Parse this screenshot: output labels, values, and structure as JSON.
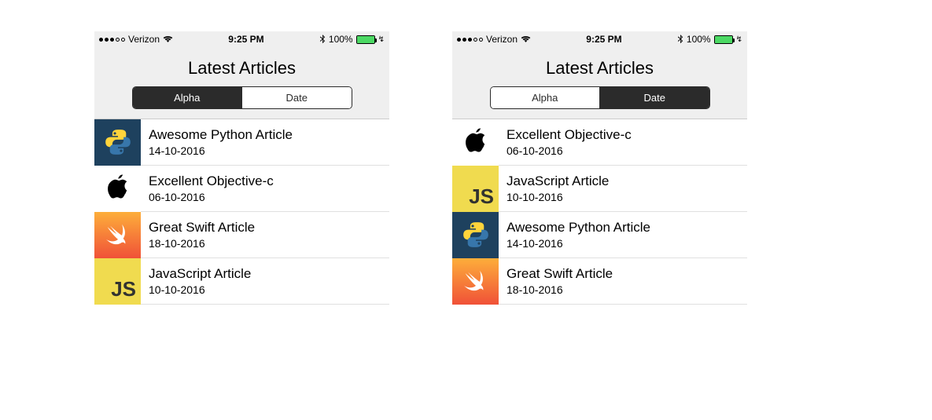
{
  "status": {
    "carrier": "Verizon",
    "time": "9:25 PM",
    "battery_pct": "100%"
  },
  "header": {
    "title": "Latest Articles",
    "segments": [
      "Alpha",
      "Date"
    ]
  },
  "screens": [
    {
      "active_segment": 0,
      "rows": [
        {
          "icon": "python",
          "title": "Awesome Python Article",
          "date": "14-10-2016"
        },
        {
          "icon": "apple",
          "title": "Excellent Objective-c",
          "date": "06-10-2016"
        },
        {
          "icon": "swift",
          "title": "Great Swift Article",
          "date": "18-10-2016"
        },
        {
          "icon": "js",
          "title": "JavaScript Article",
          "date": "10-10-2016"
        }
      ]
    },
    {
      "active_segment": 1,
      "rows": [
        {
          "icon": "apple",
          "title": "Excellent Objective-c",
          "date": "06-10-2016"
        },
        {
          "icon": "js",
          "title": "JavaScript Article",
          "date": "10-10-2016"
        },
        {
          "icon": "python",
          "title": "Awesome Python Article",
          "date": "14-10-2016"
        },
        {
          "icon": "swift",
          "title": "Great Swift Article",
          "date": "18-10-2016"
        }
      ]
    }
  ]
}
